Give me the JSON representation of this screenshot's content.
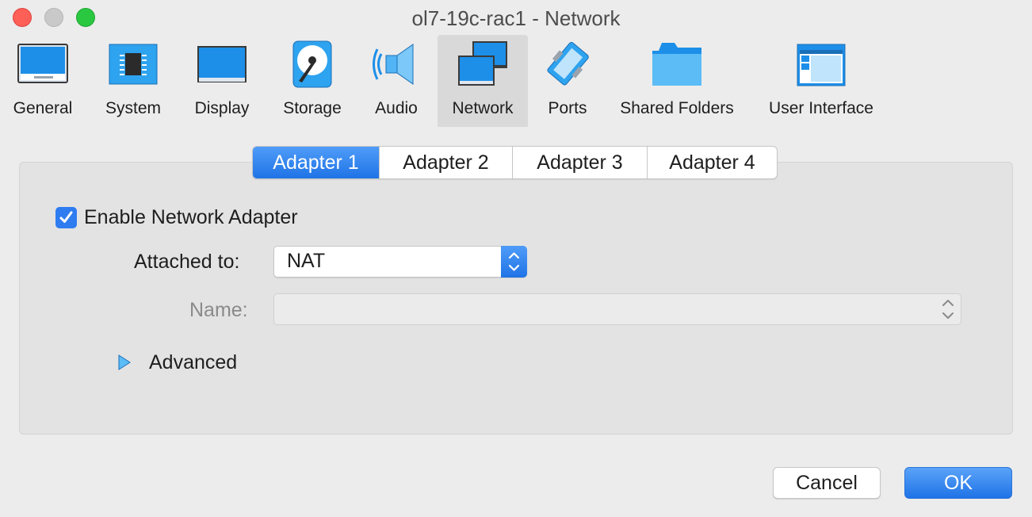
{
  "window": {
    "title": "ol7-19c-rac1 - Network"
  },
  "toolbar": {
    "items": [
      {
        "label": "General",
        "icon": "general-icon"
      },
      {
        "label": "System",
        "icon": "system-chip-icon"
      },
      {
        "label": "Display",
        "icon": "display-monitor-icon"
      },
      {
        "label": "Storage",
        "icon": "storage-disk-icon"
      },
      {
        "label": "Audio",
        "icon": "audio-speaker-icon"
      },
      {
        "label": "Network",
        "icon": "network-icon",
        "selected": true
      },
      {
        "label": "Ports",
        "icon": "ports-connector-icon"
      },
      {
        "label": "Shared Folders",
        "icon": "folder-icon"
      },
      {
        "label": "User Interface",
        "icon": "user-interface-window-icon"
      }
    ]
  },
  "tabs": [
    {
      "label": "Adapter 1",
      "selected": true
    },
    {
      "label": "Adapter 2"
    },
    {
      "label": "Adapter 3"
    },
    {
      "label": "Adapter 4"
    }
  ],
  "adapter": {
    "enable_label": "Enable Network Adapter",
    "enabled": true,
    "attached_to_label": "Attached to:",
    "attached_to_value": "NAT",
    "name_label": "Name:",
    "name_value": "",
    "advanced_label": "Advanced"
  },
  "buttons": {
    "cancel": "Cancel",
    "ok": "OK"
  },
  "colors": {
    "accent": "#1f73e6",
    "selected_tab_bg": "#d9d9d9"
  }
}
